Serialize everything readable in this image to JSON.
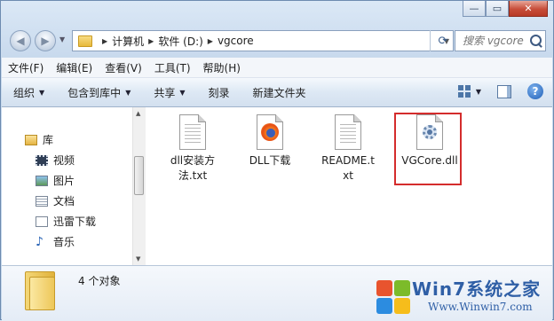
{
  "window": {
    "caption": {
      "minimize": "—",
      "maximize": "▭",
      "close": "✕"
    }
  },
  "nav": {
    "back_icon": "back-arrow-icon",
    "forward_icon": "forward-arrow-icon",
    "breadcrumb": [
      "计算机",
      "软件 (D:)",
      "vgcore"
    ],
    "search_placeholder": "搜索 vgcore"
  },
  "menu": [
    "文件(F)",
    "编辑(E)",
    "查看(V)",
    "工具(T)",
    "帮助(H)"
  ],
  "toolbar": {
    "organize": "组织",
    "include_in_library": "包含到库中",
    "share": "共享",
    "burn": "刻录",
    "new_folder": "新建文件夹",
    "help": "?"
  },
  "sidebar": {
    "items": [
      {
        "label": "库",
        "icon": "library-icon"
      },
      {
        "label": "视频",
        "icon": "video-icon"
      },
      {
        "label": "图片",
        "icon": "picture-icon"
      },
      {
        "label": "文档",
        "icon": "document-icon"
      },
      {
        "label": "迅雷下载",
        "icon": "download-icon"
      },
      {
        "label": "音乐",
        "icon": "music-icon"
      }
    ]
  },
  "files": [
    {
      "name": "dll安装方法.txt",
      "line1": "dll安装方",
      "line2": "法.txt",
      "icon": "text-file-icon"
    },
    {
      "name": "DLL下载",
      "line1": "DLL下载",
      "line2": "",
      "icon": "firefox-link-icon"
    },
    {
      "name": "README.txt",
      "line1": "README.t",
      "line2": "xt",
      "icon": "text-file-icon"
    },
    {
      "name": "VGCore.dll",
      "line1": "VGCore.dll",
      "line2": "",
      "icon": "dll-gear-icon",
      "highlighted": true
    }
  ],
  "details": {
    "item_count": "4 个对象"
  },
  "watermark": {
    "title": "Win7系统之家",
    "url": "Www.Winwin7.com"
  },
  "colors": {
    "highlight": "#d42c2c",
    "accent": "#2f5fa6"
  }
}
